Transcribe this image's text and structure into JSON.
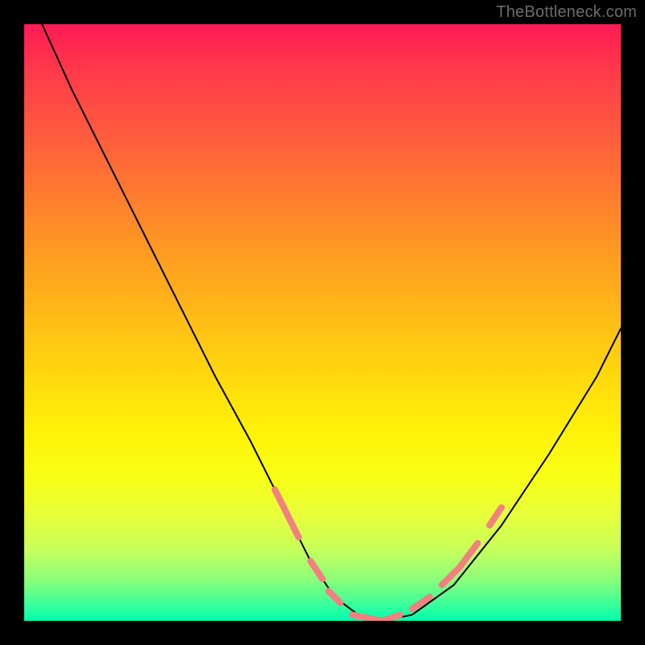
{
  "watermark": {
    "text": "TheBottleneck.com"
  },
  "chart_data": {
    "type": "line",
    "title": "",
    "xlabel": "",
    "ylabel": "",
    "xlim": [
      0,
      100
    ],
    "ylim": [
      0,
      100
    ],
    "grid": false,
    "legend": false,
    "background_gradient": {
      "direction": "vertical",
      "stops": [
        {
          "pos": 0.0,
          "color": "#ff1a55"
        },
        {
          "pos": 0.5,
          "color": "#ffc800"
        },
        {
          "pos": 0.8,
          "color": "#f0ff30"
        },
        {
          "pos": 1.0,
          "color": "#00ffb0"
        }
      ]
    },
    "series": [
      {
        "name": "bottleneck-curve",
        "color": "#000000",
        "stroke_width": 2,
        "x": [
          3,
          8,
          14,
          20,
          26,
          32,
          38,
          44,
          48,
          52,
          56,
          60,
          65,
          72,
          80,
          88,
          96,
          100
        ],
        "y": [
          100,
          89,
          77,
          65,
          53,
          41,
          30,
          18,
          10,
          4,
          1,
          0,
          1,
          6,
          16,
          28,
          41,
          49
        ]
      },
      {
        "name": "highlight-segments",
        "color": "#f28080",
        "stroke_width": 8,
        "segments": [
          {
            "x": [
              42,
              44,
              46
            ],
            "y": [
              22,
              18,
              14
            ]
          },
          {
            "x": [
              48,
              50
            ],
            "y": [
              10,
              7
            ]
          },
          {
            "x": [
              51,
              53
            ],
            "y": [
              5,
              3
            ]
          },
          {
            "x": [
              55,
              60,
              63
            ],
            "y": [
              1,
              0,
              1
            ]
          },
          {
            "x": [
              65,
              68
            ],
            "y": [
              2,
              4
            ]
          },
          {
            "x": [
              70,
              73,
              76
            ],
            "y": [
              6,
              9,
              13
            ]
          },
          {
            "x": [
              78,
              80
            ],
            "y": [
              16,
              19
            ]
          }
        ]
      }
    ]
  }
}
